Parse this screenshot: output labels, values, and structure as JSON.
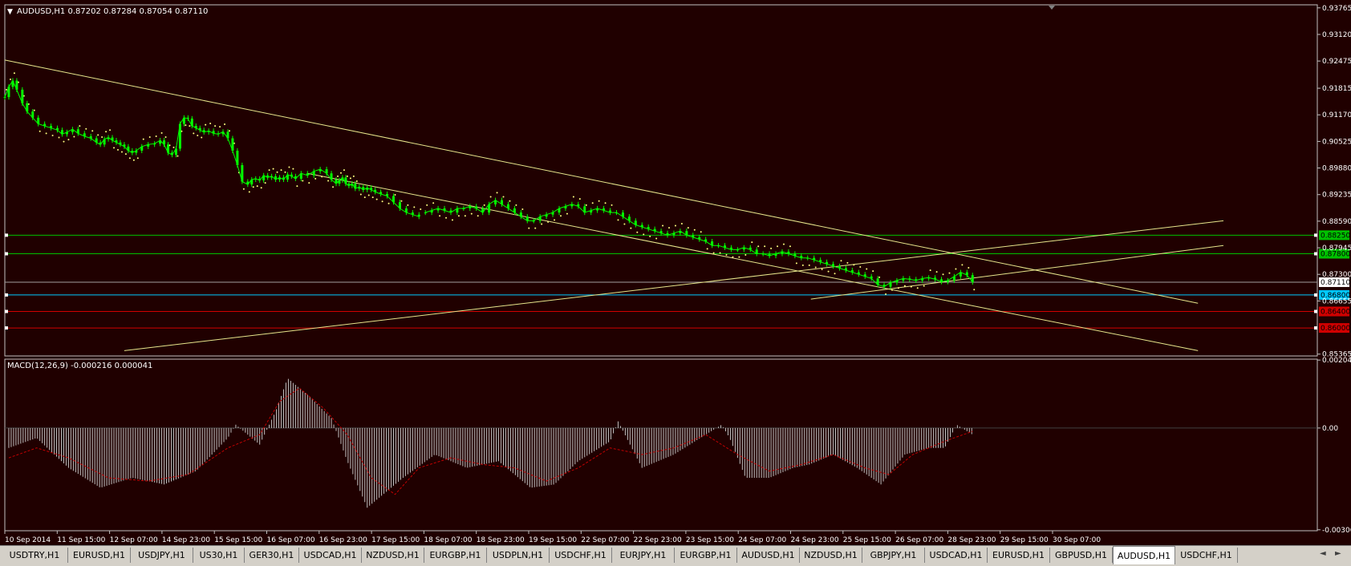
{
  "chart_header": {
    "title": "AUDUSD,H1  0.87202 0.87284 0.87054 0.87110",
    "collapse_marker": "▼"
  },
  "macd_header": {
    "title": "MACD(12,26,9) -0.000216 0.000041"
  },
  "colors": {
    "background": "#200000",
    "bull_candle": "#00ff00",
    "frame": "#c0c0c0",
    "channel_line": "#e6e68c",
    "green_level": "#00c000",
    "cyan_level": "#00c8ff",
    "red_level": "#d00000",
    "sar": "#ffff80",
    "macd_hist": "#c0c0c0",
    "macd_signal": "#c00000"
  },
  "chart_data": [
    {
      "type": "line",
      "name": "price",
      "symbol": "AUDUSD",
      "timeframe": "H1",
      "ohlc_last": {
        "open": 0.87202,
        "high": 0.87284,
        "low": 0.87054,
        "close": 0.8711
      },
      "x_labels": [
        "10 Sep 2014",
        "11 Sep 15:00",
        "12 Sep 07:00",
        "14 Sep 23:00",
        "15 Sep 15:00",
        "16 Sep 07:00",
        "16 Sep 23:00",
        "17 Sep 15:00",
        "18 Sep 07:00",
        "18 Sep 23:00",
        "19 Sep 15:00",
        "22 Sep 07:00",
        "22 Sep 23:00",
        "23 Sep 15:00",
        "24 Sep 07:00",
        "24 Sep 23:00",
        "25 Sep 15:00",
        "26 Sep 07:00",
        "28 Sep 23:00",
        "29 Sep 15:00",
        "30 Sep 07:00"
      ],
      "y_ticks": [
        "0.93765",
        "0.93120",
        "0.92475",
        "0.91815",
        "0.91170",
        "0.90525",
        "0.89880",
        "0.89235",
        "0.88590",
        "0.87945",
        "0.87300",
        "0.86655",
        "0.85365"
      ],
      "ylim": [
        0.8534,
        0.938
      ],
      "path_x": [
        0,
        5,
        10,
        15,
        22,
        28,
        35,
        42,
        50,
        58,
        66,
        72,
        78,
        85,
        92,
        100,
        108,
        115,
        120,
        125,
        130,
        135,
        140,
        145,
        150,
        155,
        160,
        165,
        172,
        180,
        188,
        195,
        200,
        205,
        210,
        215,
        220,
        225,
        230,
        235,
        240,
        245,
        250,
        256,
        262,
        268,
        274,
        280,
        286,
        292,
        298,
        305,
        310,
        315,
        320,
        325,
        330,
        335,
        340,
        345,
        350,
        355,
        360,
        365,
        372,
        380,
        388,
        396,
        404,
        410,
        416,
        420,
        424,
        428,
        432,
        436,
        440,
        445,
        450,
        455,
        460,
        465,
        472,
        480,
        488,
        496,
        504,
        512,
        520
      ],
      "path_y": [
        0.916,
        0.9185,
        0.92,
        0.9178,
        0.9145,
        0.9125,
        0.911,
        0.9095,
        0.909,
        0.9085,
        0.908,
        0.907,
        0.9075,
        0.9082,
        0.9072,
        0.9065,
        0.906,
        0.905,
        0.9045,
        0.9058,
        0.9062,
        0.9055,
        0.905,
        0.9045,
        0.904,
        0.903,
        0.9025,
        0.903,
        0.904,
        0.9045,
        0.9047,
        0.9055,
        0.9045,
        0.9025,
        0.902,
        0.9035,
        0.9095,
        0.911,
        0.9108,
        0.909,
        0.9085,
        0.908,
        0.9075,
        0.9078,
        0.9072,
        0.907,
        0.9076,
        0.906,
        0.903,
        0.8995,
        0.8955,
        0.8948,
        0.896,
        0.8962,
        0.8958,
        0.897,
        0.8965,
        0.8968,
        0.896,
        0.8965,
        0.896,
        0.8972,
        0.8968,
        0.8962,
        0.8975,
        0.897,
        0.898,
        0.8985,
        0.8975,
        0.896,
        0.895,
        0.8958,
        0.8965,
        0.895,
        0.8945,
        0.895,
        0.8938,
        0.8942,
        0.8935,
        0.894,
        0.8935,
        0.893,
        0.8925,
        0.892,
        0.8905,
        0.889,
        0.888,
        0.8875,
        0.887
      ]
    },
    {
      "type": "line",
      "name": "price_part2",
      "path_x": [
        528,
        536,
        544,
        552,
        560,
        568,
        576,
        584,
        592,
        600,
        608,
        616,
        624,
        632,
        640,
        648,
        656,
        664,
        672,
        680,
        688,
        696,
        704,
        712,
        720,
        728,
        736,
        744,
        752,
        760,
        768,
        776,
        784,
        792,
        800,
        808,
        816,
        824,
        832,
        840,
        848,
        856,
        864,
        872,
        880,
        888,
        896,
        904,
        912,
        920,
        928,
        936,
        944,
        952,
        960,
        968,
        976,
        984,
        992,
        1000,
        1008,
        1016,
        1024,
        1032,
        1040,
        1048,
        1056,
        1064,
        1072,
        1080,
        1088,
        1096,
        1104,
        1112,
        1120,
        1128,
        1136,
        1144,
        1152,
        1160,
        1168,
        1176,
        1184,
        1192,
        1200,
        1208,
        1215
      ],
      "path_y": [
        0.888,
        0.8885,
        0.889,
        0.8885,
        0.888,
        0.889,
        0.889,
        0.8895,
        0.889,
        0.888,
        0.89,
        0.891,
        0.89,
        0.889,
        0.888,
        0.887,
        0.886,
        0.886,
        0.887,
        0.8875,
        0.888,
        0.889,
        0.8895,
        0.89,
        0.8895,
        0.888,
        0.8885,
        0.889,
        0.8885,
        0.888,
        0.888,
        0.887,
        0.886,
        0.885,
        0.8845,
        0.884,
        0.8835,
        0.883,
        0.8825,
        0.883,
        0.8835,
        0.8825,
        0.882,
        0.8815,
        0.881,
        0.88,
        0.88,
        0.8795,
        0.879,
        0.879,
        0.8795,
        0.879,
        0.878,
        0.878,
        0.8775,
        0.878,
        0.8785,
        0.878,
        0.8775,
        0.877,
        0.877,
        0.8765,
        0.876,
        0.8755,
        0.875,
        0.8745,
        0.874,
        0.8735,
        0.873,
        0.8725,
        0.872,
        0.8705,
        0.87,
        0.871,
        0.8715,
        0.872,
        0.8718,
        0.8715,
        0.872,
        0.8722,
        0.8718,
        0.8712,
        0.8715,
        0.8725,
        0.8735,
        0.8728,
        0.8711
      ]
    },
    {
      "type": "line",
      "name": "trend_channel",
      "lines": [
        {
          "x": [
            0,
            1498
          ],
          "y": [
            0.925,
            0.866
          ]
        },
        {
          "x": [
            380,
            1498
          ],
          "y": [
            0.8975,
            0.8545
          ]
        },
        {
          "x": [
            150,
            1530
          ],
          "y": [
            0.8545,
            0.886
          ]
        },
        {
          "x": [
            1012,
            1530
          ],
          "y": [
            0.867,
            0.88
          ]
        }
      ]
    },
    {
      "type": "line",
      "name": "horizontal_levels",
      "levels": [
        {
          "label": "0.88250",
          "value": 0.8825,
          "kind": "green"
        },
        {
          "label": "0.87800",
          "value": 0.878,
          "kind": "green"
        },
        {
          "label": "0.87110",
          "value": 0.8711,
          "kind": "price"
        },
        {
          "label": "0.86800",
          "value": 0.868,
          "kind": "cyan"
        },
        {
          "label": "0.86400",
          "value": 0.864,
          "kind": "red"
        },
        {
          "label": "0.86000",
          "value": 0.86,
          "kind": "red"
        }
      ]
    },
    {
      "type": "bar",
      "name": "macd",
      "y_ticks": [
        "0.002047",
        "0.00",
        "-0.003065"
      ],
      "ylim": [
        -0.00307,
        0.00205
      ],
      "hist_x": [
        5,
        40,
        80,
        120,
        160,
        200,
        240,
        280,
        290,
        320,
        340,
        355,
        380,
        410,
        430,
        455,
        475,
        500,
        540,
        580,
        620,
        660,
        690,
        720,
        760,
        770,
        800,
        840,
        880,
        900,
        910,
        930,
        960,
        990,
        1010,
        1040,
        1070,
        1100,
        1130,
        1160,
        1180,
        1195,
        1215
      ],
      "hist_y": [
        -0.0006,
        -0.0003,
        -0.0012,
        -0.0018,
        -0.0015,
        -0.0017,
        -0.0013,
        -0.0003,
        0.0001,
        -0.0005,
        0.0005,
        0.0015,
        0.001,
        0.0003,
        -0.001,
        -0.0024,
        -0.002,
        -0.0015,
        -0.0008,
        -0.0012,
        -0.001,
        -0.0018,
        -0.0017,
        -0.001,
        -0.0004,
        0.0002,
        -0.0012,
        -0.0008,
        -0.0002,
        0.0001,
        -0.0003,
        -0.0015,
        -0.0015,
        -0.0012,
        -0.0011,
        -0.0008,
        -0.0012,
        -0.0017,
        -0.0008,
        -0.0006,
        -0.0006,
        0.0001,
        -0.0002
      ],
      "signal_x": [
        5,
        40,
        80,
        130,
        180,
        230,
        280,
        320,
        345,
        370,
        400,
        430,
        460,
        490,
        520,
        560,
        600,
        640,
        680,
        720,
        760,
        800,
        840,
        880,
        920,
        960,
        1000,
        1040,
        1080,
        1110,
        1140,
        1180,
        1215
      ],
      "signal_y": [
        -0.0009,
        -0.0006,
        -0.0009,
        -0.0015,
        -0.0016,
        -0.0014,
        -0.0006,
        -0.0002,
        0.0008,
        0.0012,
        0.0006,
        -0.0002,
        -0.0015,
        -0.002,
        -0.0012,
        -0.0009,
        -0.0011,
        -0.0012,
        -0.0016,
        -0.0012,
        -0.0006,
        -0.0008,
        -0.0006,
        -0.0002,
        -0.0008,
        -0.0013,
        -0.0011,
        -0.0008,
        -0.0012,
        -0.0014,
        -0.0008,
        -0.0004,
        -0.0001
      ]
    }
  ],
  "tabs": [
    "USDTRY,H1",
    "EURUSD,H1",
    "USDJPY,H1",
    "US30,H1",
    "GER30,H1",
    "USDCAD,H1",
    "NZDUSD,H1",
    "EURGBP,H1",
    "USDPLN,H1",
    "USDCHF,H1",
    "EURJPY,H1",
    "EURGBP,H1",
    "AUDUSD,H1",
    "NZDUSD,H1",
    "GBPJPY,H1",
    "USDCAD,H1",
    "EURUSD,H1",
    "GBPUSD,H1",
    "AUDUSD,H1",
    "USDCHF,H1"
  ],
  "active_tab_index": 18,
  "tab_scroll": {
    "left": "◄",
    "right": "►"
  }
}
